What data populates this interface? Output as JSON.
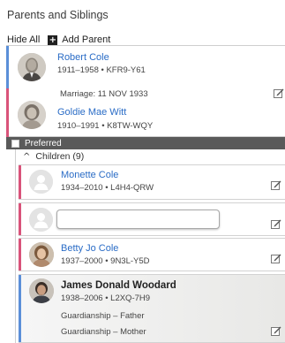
{
  "section_title": "Parents and Siblings",
  "toolbar": {
    "hide_all": "Hide All",
    "add_parent": "Add Parent",
    "plus_glyph": "+"
  },
  "parents": [
    {
      "name": "Robert Cole",
      "meta": "1911–1958 • KFR9-Y61",
      "gender_color": "#5b8fd8"
    },
    {
      "name": "Goldie Mae Witt",
      "meta": "1910–1991 • K8TW-WQY",
      "gender_color": "#d9537a"
    }
  ],
  "marriage": "Marriage: 11 NOV 1933",
  "preferred_label": "Preferred",
  "children": {
    "header": "Children (9)",
    "caret": "^",
    "items": [
      {
        "name": "Monette Cole",
        "meta": "1934–2010 • L4H4-QRW",
        "gender_color": "#d9537a"
      },
      {
        "name": "",
        "meta": "",
        "gender_color": "#d9537a"
      },
      {
        "name": "Betty Jo Cole",
        "meta": "1937–2000 • 9N3L-Y5D",
        "gender_color": "#d9537a"
      },
      {
        "name": "James Donald Woodard",
        "meta": "1938–2006 • L2XQ-7H9",
        "gender_color": "#5b8fd8",
        "guardianship": [
          "Guardianship – Father",
          "Guardianship – Mother"
        ]
      }
    ]
  }
}
